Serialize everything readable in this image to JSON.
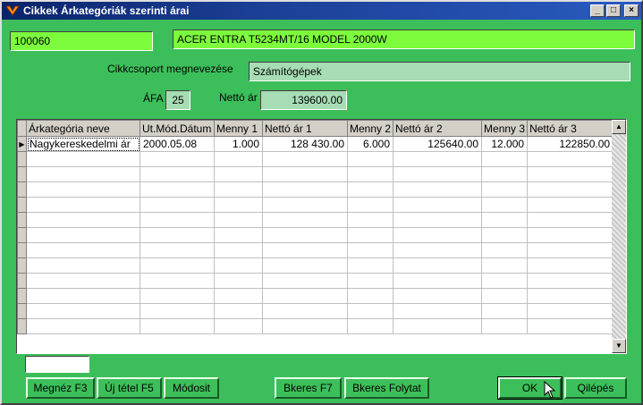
{
  "window": {
    "title": "Cikkek Árkategóriák szerinti árai",
    "minimize": "_",
    "maximize": "□",
    "close": "×"
  },
  "header": {
    "code_value": "100060",
    "product_name": "ACER ENTRA T5234MT/16 MODEL 2000W",
    "group_label": "Cikkcsoport megnevezése",
    "group_value": "Számítógépek",
    "vat_label": "ÁFA",
    "vat_value": "25",
    "net_price_label": "Nettó ár",
    "net_price_value": "139600.00"
  },
  "grid": {
    "columns": [
      "Árkategória neve",
      "Ut.Mód.Dátum",
      "Menny 1",
      "Nettó ár 1",
      "Menny 2",
      "Nettó ár 2",
      "Menny 3",
      "Nettó ár 3"
    ],
    "row_indicator": "▶",
    "rows": [
      [
        "Nagykereskedelmi ár",
        "2000.05.08",
        "1.000",
        "128 430.00",
        "6.000",
        "125640.00",
        "12.000",
        "122850.00"
      ]
    ],
    "scroll_up": "▲",
    "scroll_down": "▼"
  },
  "footer": {
    "status_value": "",
    "buttons": {
      "view": "Megnéz F3",
      "new_item": "Új tétel F5",
      "modify": "Módosit",
      "search": "Bkeres F7",
      "search_continue": "Bkeres Folytat",
      "ok": "OK",
      "exit": "Qilépés"
    }
  },
  "colors": {
    "window_bg": "#3cbf5a",
    "lime_field": "#7cfc3c",
    "readonly_field": "#a6ddb4",
    "selection": "#0a246a"
  }
}
